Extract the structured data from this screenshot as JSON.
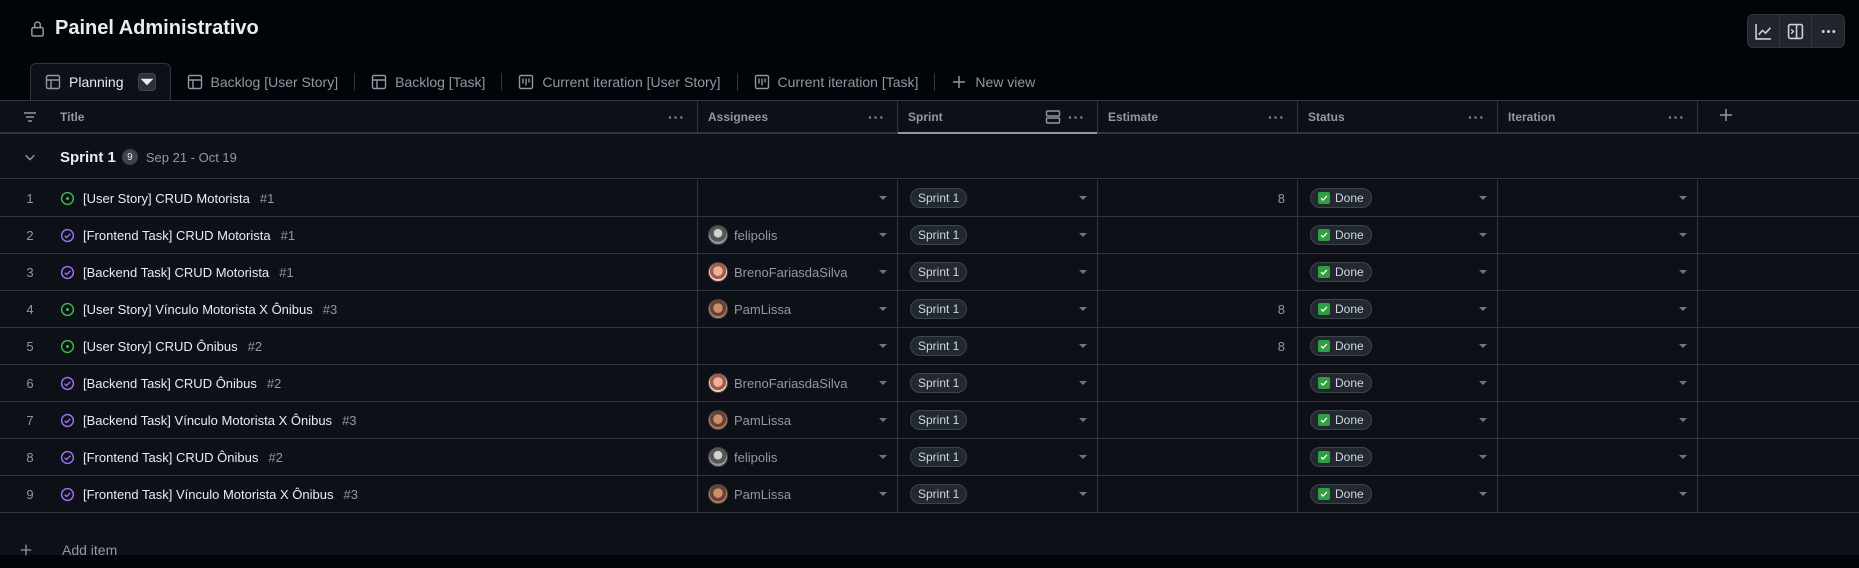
{
  "header": {
    "title": "Painel Administrativo"
  },
  "tabs": [
    {
      "label": "Planning",
      "icon": "table-icon",
      "active": true
    },
    {
      "label": "Backlog [User Story]",
      "icon": "table-icon"
    },
    {
      "label": "Backlog [Task]",
      "icon": "table-icon"
    },
    {
      "label": "Current iteration [User Story]",
      "icon": "board-icon"
    },
    {
      "label": "Current iteration [Task]",
      "icon": "board-icon"
    },
    {
      "label": "New view",
      "icon": "plus-icon"
    }
  ],
  "columns": [
    "Title",
    "Assignees",
    "Sprint",
    "Estimate",
    "Status",
    "Iteration"
  ],
  "group": {
    "name": "Sprint 1",
    "count": "9",
    "dates": "Sep 21 - Oct 19"
  },
  "rows": [
    {
      "num": "1",
      "type": "open",
      "title": "[User Story] CRUD Motorista",
      "ref": "#1",
      "assignee": "",
      "avatar": "",
      "sprint": "Sprint 1",
      "estimate": "8",
      "status": "Done"
    },
    {
      "num": "2",
      "type": "closed",
      "title": "[Frontend Task] CRUD Motorista",
      "ref": "#1",
      "assignee": "felipolis",
      "avatar": "felipolis",
      "sprint": "Sprint 1",
      "estimate": "",
      "status": "Done"
    },
    {
      "num": "3",
      "type": "closed",
      "title": "[Backend Task] CRUD Motorista",
      "ref": "#1",
      "assignee": "BrenoFariasdaSilva",
      "avatar": "breno",
      "sprint": "Sprint 1",
      "estimate": "",
      "status": "Done"
    },
    {
      "num": "4",
      "type": "open",
      "title": "[User Story] Vínculo Motorista X Ônibus",
      "ref": "#3",
      "assignee": "PamLissa",
      "avatar": "pam",
      "sprint": "Sprint 1",
      "estimate": "8",
      "status": "Done"
    },
    {
      "num": "5",
      "type": "open",
      "title": "[User Story] CRUD Ônibus",
      "ref": "#2",
      "assignee": "",
      "avatar": "",
      "sprint": "Sprint 1",
      "estimate": "8",
      "status": "Done"
    },
    {
      "num": "6",
      "type": "closed",
      "title": "[Backend Task] CRUD Ônibus",
      "ref": "#2",
      "assignee": "BrenoFariasdaSilva",
      "avatar": "breno",
      "sprint": "Sprint 1",
      "estimate": "",
      "status": "Done"
    },
    {
      "num": "7",
      "type": "closed",
      "title": "[Backend Task] Vínculo Motorista X Ônibus",
      "ref": "#3",
      "assignee": "PamLissa",
      "avatar": "pam",
      "sprint": "Sprint 1",
      "estimate": "",
      "status": "Done"
    },
    {
      "num": "8",
      "type": "closed",
      "title": "[Frontend Task] CRUD Ônibus",
      "ref": "#2",
      "assignee": "felipolis",
      "avatar": "felipolis",
      "sprint": "Sprint 1",
      "estimate": "",
      "status": "Done"
    },
    {
      "num": "9",
      "type": "closed",
      "title": "[Frontend Task] Vínculo Motorista X Ônibus",
      "ref": "#3",
      "assignee": "PamLissa",
      "avatar": "pam",
      "sprint": "Sprint 1",
      "estimate": "",
      "status": "Done"
    }
  ],
  "add_item": "Add item",
  "colors": {
    "open": "#3fb950",
    "closed": "#a371f7",
    "done": "#2ea043"
  }
}
